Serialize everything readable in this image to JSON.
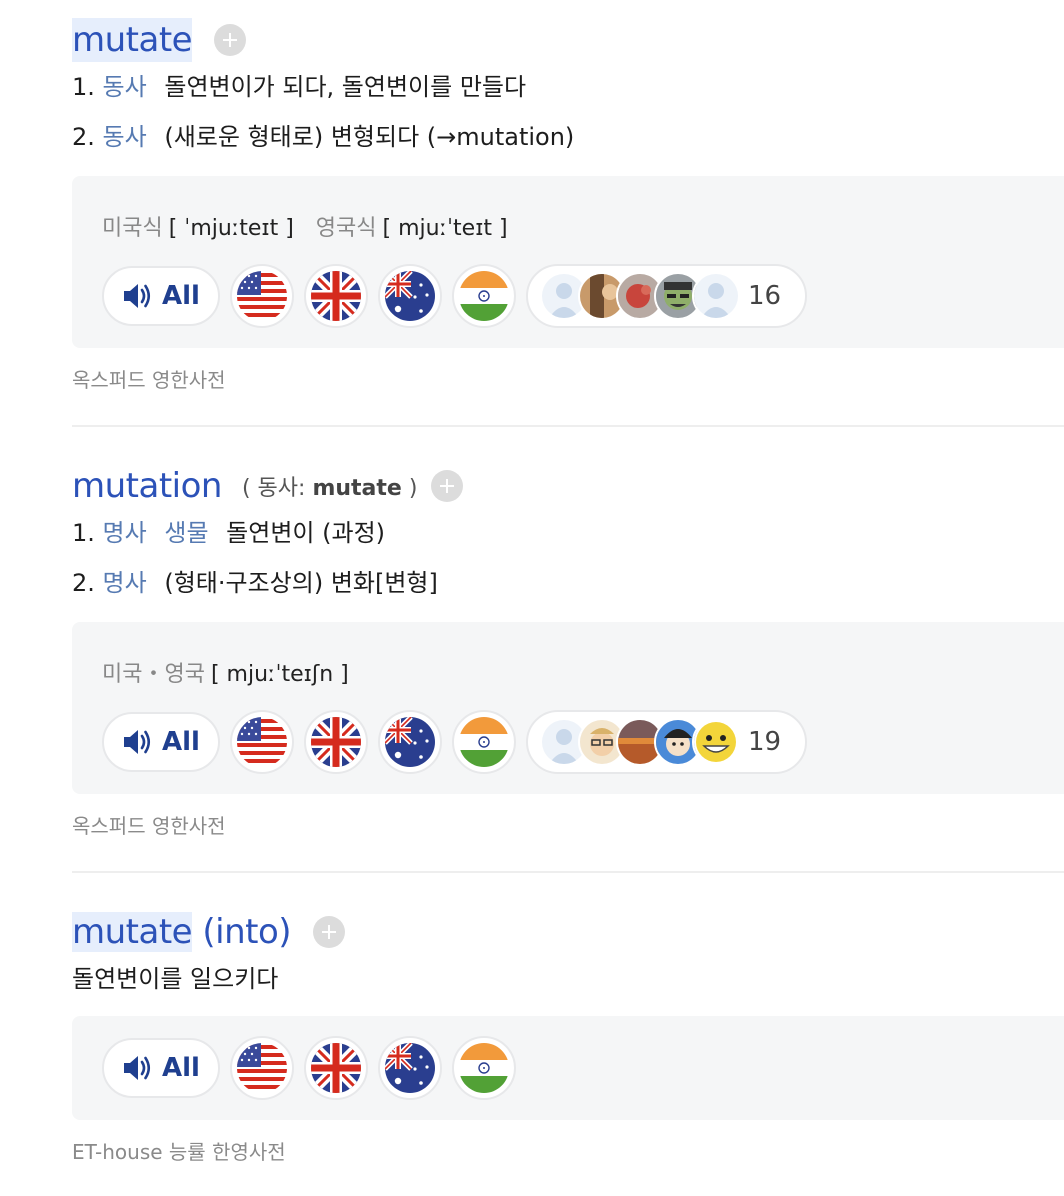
{
  "entries": [
    {
      "headword": "mutate",
      "meanings": [
        {
          "num": "1.",
          "pos": "동사",
          "text": "돌연변이가 되다, 돌연변이를 만들다"
        },
        {
          "num": "2.",
          "pos": "동사",
          "text": "(새로운 형태로) 변형되다 (→mutation)"
        }
      ],
      "pronunciation": {
        "us_label": "미국식",
        "us_ipa": "[ ˈmjuːteɪt ]",
        "uk_label": "영국식",
        "uk_ipa": "[ mjuːˈteɪt ]"
      },
      "all_label": "All",
      "user_count": "16",
      "source": "옥스퍼드 영한사전"
    },
    {
      "headword": "mutation",
      "related_open": "( 동사:",
      "related_word": "mutate",
      "related_close": ")",
      "meanings": [
        {
          "num": "1.",
          "pos": "명사",
          "field": "생물",
          "text": "돌연변이 (과정)"
        },
        {
          "num": "2.",
          "pos": "명사",
          "text": "(형태·구조상의) 변화[변형]"
        }
      ],
      "pronunciation": {
        "label": "미국・영국",
        "ipa": "[ mjuːˈteɪʃn ]"
      },
      "all_label": "All",
      "user_count": "19",
      "source": "옥스퍼드 영한사전"
    },
    {
      "headword": "mutate",
      "headword_suffix": " (into)",
      "meaning": "돌연변이를 일으키다",
      "all_label": "All",
      "source": "ET-house 능률 한영사전"
    }
  ],
  "icons": {
    "speaker": "speaker-icon",
    "flags": [
      "us-flag-icon",
      "uk-flag-icon",
      "au-flag-icon",
      "in-flag-icon"
    ],
    "add": "plus-icon"
  },
  "colors": {
    "headword": "#2c52b8",
    "pos": "#567ab2",
    "all_button": "#1f3f8f"
  }
}
